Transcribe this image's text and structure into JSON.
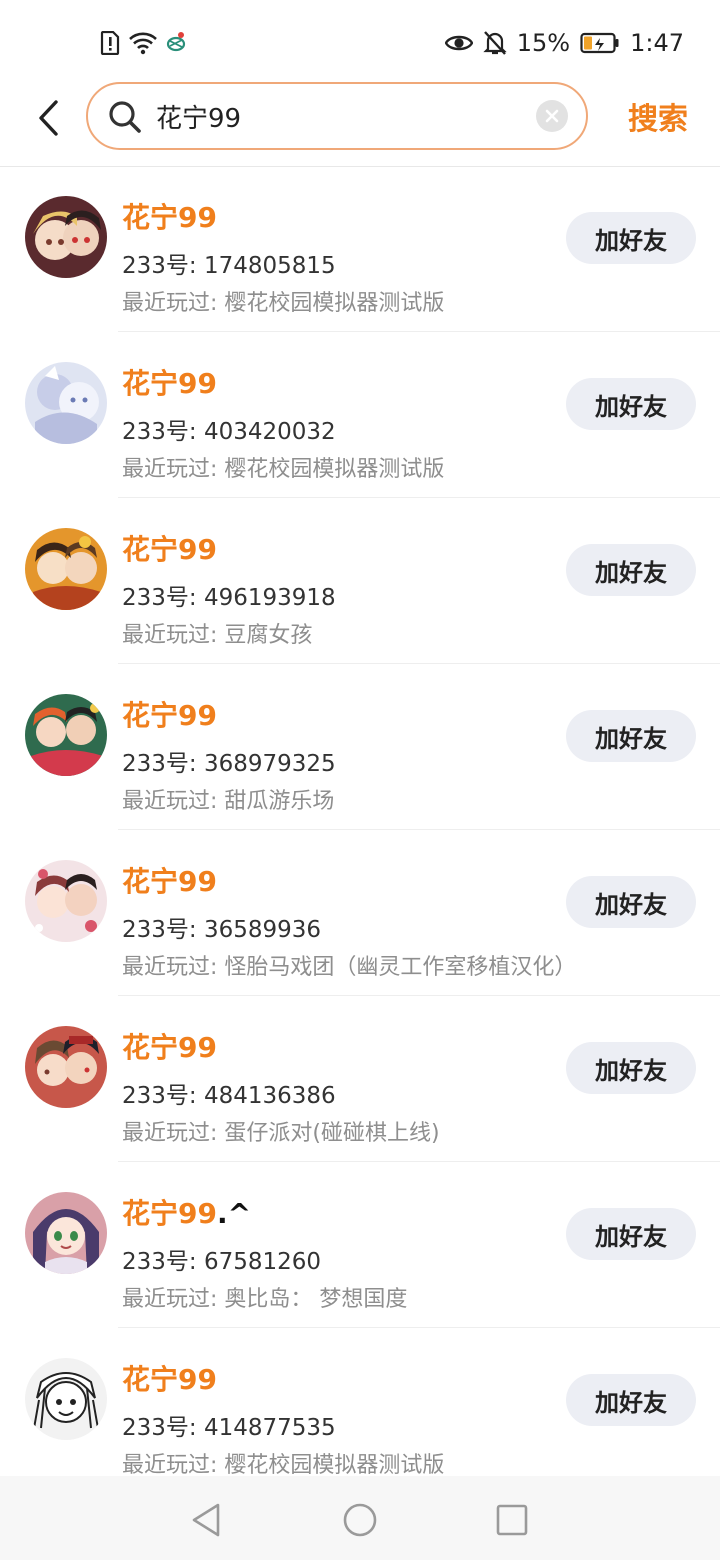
{
  "status_bar": {
    "battery_percent": "15%",
    "time": "1:47",
    "icons": [
      "sim-alert-icon",
      "wifi-icon",
      "carrier-icon",
      "eye-icon",
      "bell-off-icon",
      "battery-icon"
    ]
  },
  "header": {
    "search_value": "花宁99",
    "search_button": "搜索"
  },
  "colors": {
    "accent": "#f07f1c",
    "search_border": "#f0a878",
    "button_bg": "#eceef4",
    "muted_text": "#8e8e8e"
  },
  "results": [
    {
      "name": "花宁99",
      "name_suffix": "",
      "uid": "233号: 174805815",
      "played": "最近玩过: 樱花校园模拟器测试版",
      "button": "加好友"
    },
    {
      "name": "花宁99",
      "name_suffix": "",
      "uid": "233号: 403420032",
      "played": "最近玩过: 樱花校园模拟器测试版",
      "button": "加好友"
    },
    {
      "name": "花宁99",
      "name_suffix": "",
      "uid": "233号: 496193918",
      "played": "最近玩过: 豆腐女孩",
      "button": "加好友"
    },
    {
      "name": "花宁99",
      "name_suffix": "",
      "uid": "233号: 368979325",
      "played": "最近玩过: 甜瓜游乐场",
      "button": "加好友"
    },
    {
      "name": "花宁99",
      "name_suffix": "",
      "uid": "233号: 36589936",
      "played": "最近玩过: 怪胎马戏团（幽灵工作室移植汉化）",
      "button": "加好友"
    },
    {
      "name": "花宁99",
      "name_suffix": "",
      "uid": "233号: 484136386",
      "played": "最近玩过: 蛋仔派对(碰碰棋上线)",
      "button": "加好友"
    },
    {
      "name": "花宁99",
      "name_suffix": ".^",
      "uid": "233号: 67581260",
      "played": "最近玩过: 奥比岛： 梦想国度",
      "button": "加好友"
    },
    {
      "name": "花宁99",
      "name_suffix": "",
      "uid": "233号: 414877535",
      "played": "最近玩过: 樱花校园模拟器测试版",
      "button": "加好友"
    }
  ],
  "nav_bar": {
    "icons": [
      "back-triangle-icon",
      "home-circle-icon",
      "recents-square-icon"
    ]
  }
}
